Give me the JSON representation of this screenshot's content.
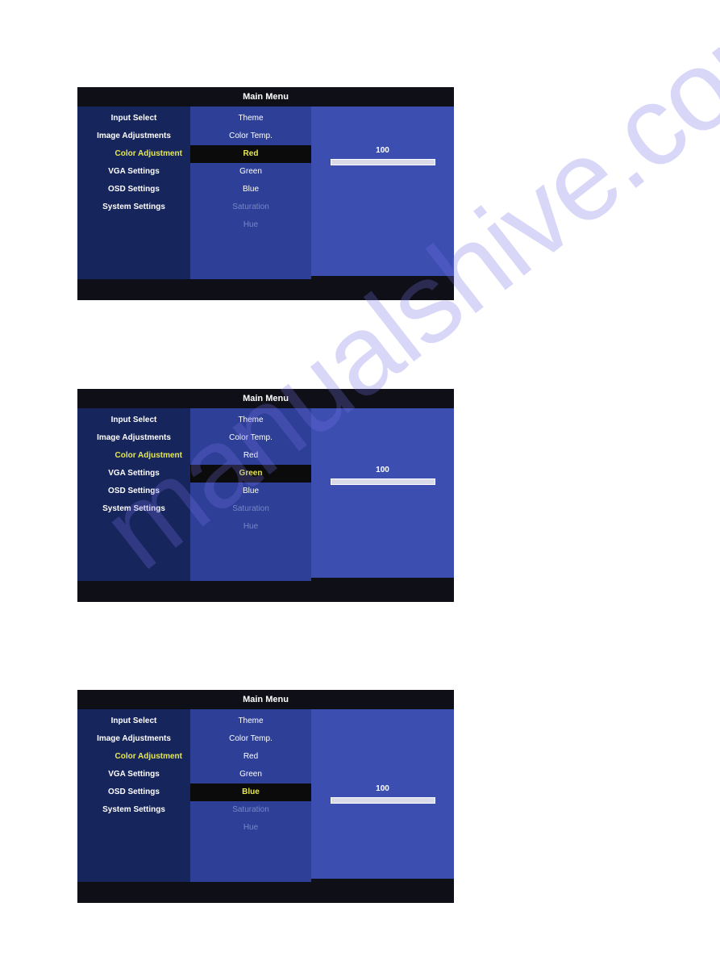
{
  "watermark": "manualshive.com",
  "panels": [
    {
      "title": "Main Menu",
      "left": [
        "Input Select",
        "Image Adjustments",
        "Color Adjustment",
        "VGA Settings",
        "OSD Settings",
        "System Settings"
      ],
      "left_selected_index": 2,
      "mid": [
        {
          "label": "Theme",
          "enabled": true
        },
        {
          "label": "Color Temp.",
          "enabled": true
        },
        {
          "label": "Red",
          "enabled": true,
          "highlighted": true
        },
        {
          "label": "Green",
          "enabled": true
        },
        {
          "label": "Blue",
          "enabled": true
        },
        {
          "label": "Saturation",
          "enabled": false
        },
        {
          "label": "Hue",
          "enabled": false
        }
      ],
      "mid_selected_index": 2,
      "value": "100",
      "slider_percent": 100
    },
    {
      "title": "Main Menu",
      "left": [
        "Input Select",
        "Image Adjustments",
        "Color Adjustment",
        "VGA Settings",
        "OSD Settings",
        "System Settings"
      ],
      "left_selected_index": 2,
      "mid": [
        {
          "label": "Theme",
          "enabled": true
        },
        {
          "label": "Color Temp.",
          "enabled": true
        },
        {
          "label": "Red",
          "enabled": true
        },
        {
          "label": "Green",
          "enabled": true,
          "highlighted": true
        },
        {
          "label": "Blue",
          "enabled": true
        },
        {
          "label": "Saturation",
          "enabled": false
        },
        {
          "label": "Hue",
          "enabled": false
        }
      ],
      "mid_selected_index": 3,
      "value": "100",
      "slider_percent": 100
    },
    {
      "title": "Main Menu",
      "left": [
        "Input Select",
        "Image Adjustments",
        "Color Adjustment",
        "VGA Settings",
        "OSD Settings",
        "System Settings"
      ],
      "left_selected_index": 2,
      "mid": [
        {
          "label": "Theme",
          "enabled": true
        },
        {
          "label": "Color Temp.",
          "enabled": true
        },
        {
          "label": "Red",
          "enabled": true
        },
        {
          "label": "Green",
          "enabled": true
        },
        {
          "label": "Blue",
          "enabled": true,
          "highlighted": true
        },
        {
          "label": "Saturation",
          "enabled": false
        },
        {
          "label": "Hue",
          "enabled": false
        }
      ],
      "mid_selected_index": 4,
      "value": "100",
      "slider_percent": 100
    }
  ]
}
